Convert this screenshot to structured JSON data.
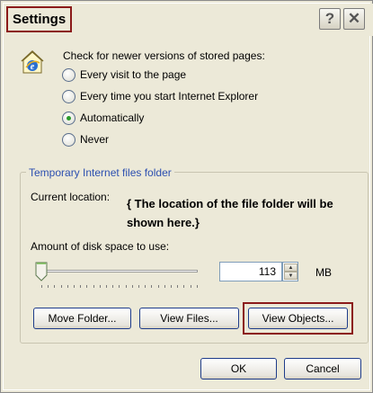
{
  "window": {
    "title": "Settings"
  },
  "titlebar": {
    "help_glyph": "?",
    "close_glyph": "✕"
  },
  "check": {
    "label": "Check for newer versions of stored pages:",
    "options": [
      {
        "label": "Every visit to the page",
        "selected": false
      },
      {
        "label": "Every time you start Internet Explorer",
        "selected": false
      },
      {
        "label": "Automatically",
        "selected": true
      },
      {
        "label": "Never",
        "selected": false
      }
    ]
  },
  "temp_folder": {
    "legend": "Temporary Internet files folder",
    "current_location_label": "Current location:",
    "location_text": "{ The location of the file folder will be shown here.}",
    "disk_space_label": "Amount of disk space to use:",
    "disk_space_value": "113",
    "disk_space_fraction": 0.02,
    "unit": "MB"
  },
  "buttons": {
    "move_folder": "Move Folder...",
    "view_files": "View Files...",
    "view_objects": "View Objects...",
    "ok": "OK",
    "cancel": "Cancel"
  },
  "icons": {
    "ie": "internet-explorer-page-icon",
    "help": "help-icon",
    "close": "close-icon"
  },
  "colors": {
    "dialog_bg": "#ece9d8",
    "highlight_border": "#8b1a1a",
    "legend_text": "#2c4fb0",
    "radio_selected": "#2b9b2b"
  }
}
